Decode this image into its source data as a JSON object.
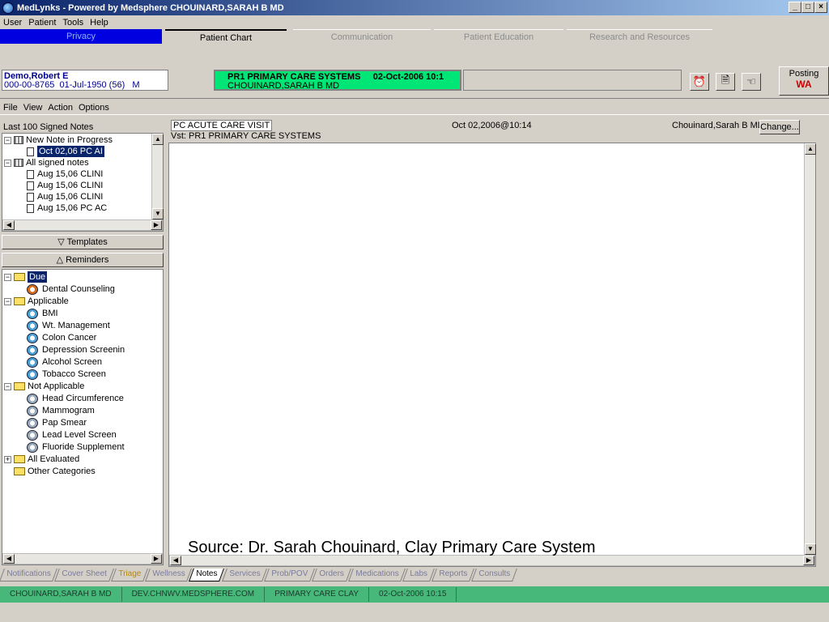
{
  "window": {
    "title": "MedLynks - Powered by Medsphere CHOUINARD,SARAH B MD"
  },
  "menu": [
    "User",
    "Patient",
    "Tools",
    "Help"
  ],
  "top_tabs": [
    "Privacy",
    "Patient Chart",
    "Communication",
    "Patient Education",
    "Research and Resources"
  ],
  "patient": {
    "name": "Demo,Robert E",
    "ssn": "000-00-8765",
    "dob": "01-Jul-1950 (56)",
    "sex": "M"
  },
  "visit": {
    "location": "PR1 PRIMARY CARE SYSTEMS",
    "date": "02-Oct-2006 10:1",
    "provider": "CHOUINARD,SARAH B MD"
  },
  "posting": {
    "label": "Posting",
    "value": "WA"
  },
  "notes_menu": [
    "File",
    "View",
    "Action",
    "Options"
  ],
  "notes": {
    "label": "Last 100 Signed Notes",
    "tree": [
      {
        "text": "New Note in Progress"
      },
      {
        "text": "Oct 02,06  PC AI"
      },
      {
        "text": "All signed notes"
      },
      {
        "text": "Aug 15,06  CLINI"
      },
      {
        "text": "Aug 15,06  CLINI"
      },
      {
        "text": "Aug 15,06  CLINI"
      },
      {
        "text": "Aug 15,06  PC AC"
      }
    ]
  },
  "sections": {
    "templates": "Templates",
    "reminders": "Reminders"
  },
  "reminders": {
    "due": {
      "label": "Due",
      "items": [
        "Dental Counseling"
      ]
    },
    "applicable": {
      "label": "Applicable",
      "items": [
        "BMI",
        "Wt. Management",
        "Colon Cancer",
        "Depression Screenin",
        "Alcohol Screen",
        "Tobacco Screen"
      ]
    },
    "not_applicable": {
      "label": "Not Applicable",
      "items": [
        "Head Circumference",
        "Mammogram",
        "Pap Smear",
        "Lead Level Screen",
        "Fluoride Supplement"
      ]
    },
    "all_evaluated": "All Evaluated",
    "other": "Other Categories"
  },
  "note_header": {
    "title": "PC ACUTE CARE VISIT",
    "visit": "Vst:  PR1 PRIMARY CARE SYSTEMS",
    "datetime": "Oct 02,2006@10:14",
    "author": "Chouinard,Sarah B MD",
    "change": "Change..."
  },
  "source_caption": "Source: Dr. Sarah Chouinard, Clay Primary Care System",
  "bottom_tabs": [
    "Notifications",
    "Cover Sheet",
    "Triage",
    "Wellness",
    "Notes",
    "Services",
    "Prob/POV",
    "Orders",
    "Medications",
    "Labs",
    "Reports",
    "Consults"
  ],
  "status": [
    "CHOUINARD,SARAH B MD",
    "DEV.CHNWV.MEDSPHERE.COM",
    "PRIMARY CARE CLAY",
    "02-Oct-2006 10:15"
  ]
}
